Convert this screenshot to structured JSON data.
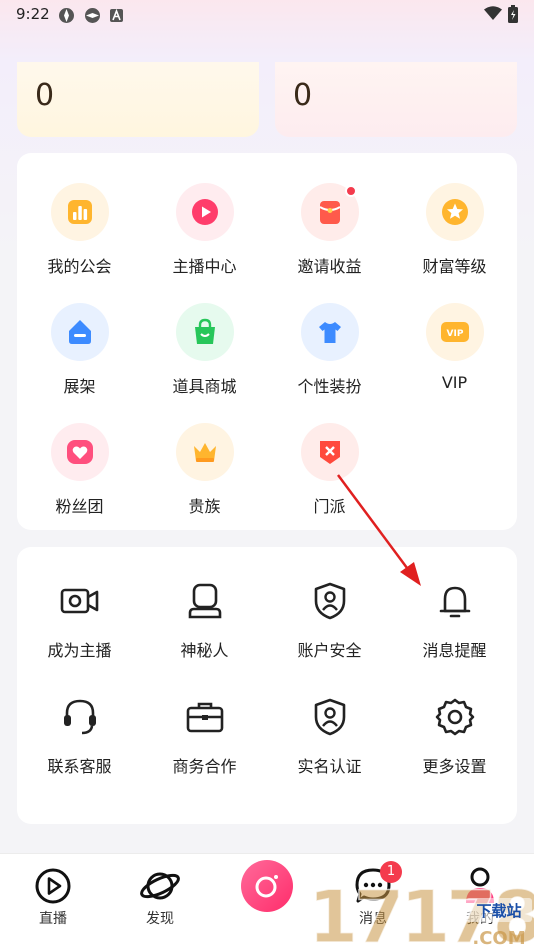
{
  "status_bar": {
    "time": "9:22"
  },
  "stats": {
    "left_value": "0",
    "right_value": "0"
  },
  "features": [
    {
      "label": "我的公会",
      "icon": "guild-icon",
      "has_dot": false
    },
    {
      "label": "主播中心",
      "icon": "anchor-center-icon",
      "has_dot": false
    },
    {
      "label": "邀请收益",
      "icon": "invite-earnings-icon",
      "has_dot": true
    },
    {
      "label": "财富等级",
      "icon": "wealth-level-icon",
      "has_dot": false
    },
    {
      "label": "展架",
      "icon": "display-shelf-icon",
      "has_dot": false
    },
    {
      "label": "道具商城",
      "icon": "props-store-icon",
      "has_dot": false
    },
    {
      "label": "个性装扮",
      "icon": "dress-up-icon",
      "has_dot": false
    },
    {
      "label": "VIP",
      "icon": "vip-icon",
      "has_dot": false
    },
    {
      "label": "粉丝团",
      "icon": "fan-club-icon",
      "has_dot": false
    },
    {
      "label": "贵族",
      "icon": "nobility-icon",
      "has_dot": false
    },
    {
      "label": "门派",
      "icon": "clan-icon",
      "has_dot": false
    }
  ],
  "services": [
    {
      "label": "成为主播",
      "icon": "camera-icon"
    },
    {
      "label": "神秘人",
      "icon": "mystery-person-icon"
    },
    {
      "label": "账户安全",
      "icon": "shield-user-icon"
    },
    {
      "label": "消息提醒",
      "icon": "bell-icon"
    },
    {
      "label": "联系客服",
      "icon": "headset-icon"
    },
    {
      "label": "商务合作",
      "icon": "briefcase-icon"
    },
    {
      "label": "实名认证",
      "icon": "id-shield-icon"
    },
    {
      "label": "更多设置",
      "icon": "gear-icon"
    }
  ],
  "tabs": [
    {
      "label": "直播",
      "icon": "play-circle-icon"
    },
    {
      "label": "发现",
      "icon": "planet-icon"
    },
    {
      "label": "",
      "icon": "camera-center-icon"
    },
    {
      "label": "消息",
      "icon": "chat-bubble-icon",
      "badge": "1"
    },
    {
      "label": "我的",
      "icon": "profile-icon"
    }
  ],
  "watermark": {
    "text": "17178",
    "subtext": "下载站",
    "domain": ".COM"
  },
  "colors": {
    "accent": "#f43b4d",
    "camera_button": "#ff3d7f",
    "annotation_arrow": "#e02020"
  }
}
